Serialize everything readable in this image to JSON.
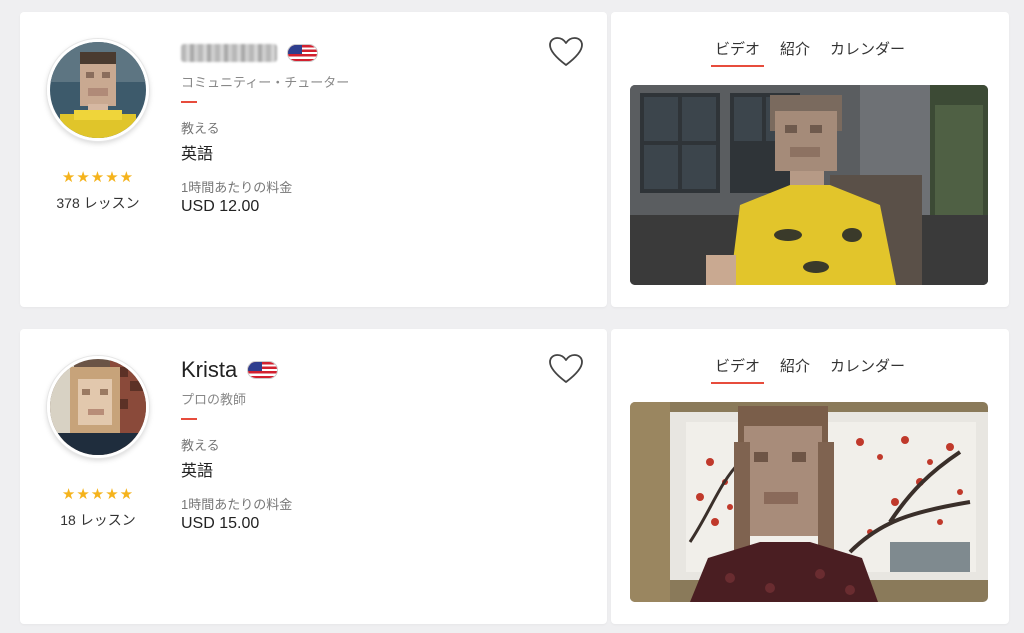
{
  "tutors": [
    {
      "name": "",
      "subtitle": "コミュニティー・チューター",
      "teaches_label": "教える",
      "teaches_value": "英語",
      "price_label": "1時間あたりの料金",
      "price_value": "USD 12.00",
      "rating_stars": "★★★★★",
      "lessons": "378 レッスン",
      "flag": "us-flag-icon",
      "tabs": [
        "ビデオ",
        "紹介",
        "カレンダー"
      ],
      "active_tab": 0
    },
    {
      "name": "Krista",
      "subtitle": "プロの教師",
      "teaches_label": "教える",
      "teaches_value": "英語",
      "price_label": "1時間あたりの料金",
      "price_value": "USD 15.00",
      "rating_stars": "★★★★★",
      "lessons": "18 レッスン",
      "flag": "us-flag-icon",
      "tabs": [
        "ビデオ",
        "紹介",
        "カレンダー"
      ],
      "active_tab": 0
    }
  ],
  "colors": {
    "accent": "#e74c3c",
    "star": "#f5b31c",
    "background": "#efeff1"
  }
}
